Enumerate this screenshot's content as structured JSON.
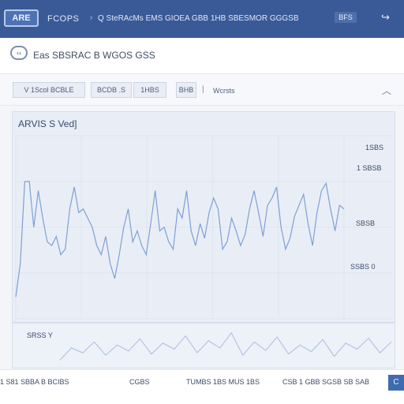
{
  "topbar": {
    "logo_text": "ARE",
    "app_name": "FCOPS",
    "nav_links": "Q SteRAcMs EMS GIOEA GBB 1HB SBESMOR GGGSB",
    "right_button": "BFS",
    "right_arrow": "↪"
  },
  "subheader": {
    "back_icon": "back-icon",
    "title": "Eas SBSRAC B WGOS GSS"
  },
  "filters": {
    "chips": [
      "V 1Scol BCBLE",
      "BCDB .S",
      "1HBS"
    ],
    "dropdown": "BHB",
    "separator": "|",
    "label": "Wcrsts",
    "collapse_icon": "chevron-up-icon"
  },
  "chart_data": {
    "type": "line",
    "title": "ARVIS S Ved]",
    "y_tick_labels": [
      "1SBS",
      "1 SBSB",
      "SBSB",
      "SSBS 0"
    ],
    "series": [
      {
        "values": [
          12,
          30,
          75,
          75,
          50,
          70,
          55,
          42,
          40,
          45,
          35,
          38,
          60,
          72,
          58,
          60,
          55,
          50,
          40,
          35,
          45,
          30,
          22,
          35,
          50,
          60,
          42,
          48,
          40,
          35,
          52,
          70,
          48,
          50,
          42,
          38,
          60,
          55,
          70,
          48,
          40,
          52,
          44,
          58,
          66,
          60,
          38,
          42,
          55,
          48,
          40,
          46,
          60,
          70,
          58,
          45,
          62,
          66,
          72,
          50,
          38,
          44,
          56,
          62,
          68,
          52,
          40,
          58,
          70,
          74,
          60,
          48,
          62,
          60
        ]
      }
    ],
    "ylim": [
      0,
      100
    ],
    "grid": true
  },
  "mini_chart": {
    "label": "SRSS Y",
    "values": [
      10,
      30,
      22,
      40,
      18,
      35,
      25,
      45,
      20,
      38,
      28,
      50,
      22,
      42,
      30,
      55,
      18,
      40,
      26,
      48,
      20,
      35,
      24,
      44,
      16,
      38,
      28,
      46,
      22,
      40
    ]
  },
  "footer": {
    "left_text": "1 S81 SBBA B BCIBS",
    "center_left": "CGBS",
    "center_right": "TUMBS 1BS MUS 1BS",
    "right_text": "CSB 1 GBB SGSB SB SAB",
    "corner_icon": "C"
  },
  "colors": {
    "topbar": "#3a5a97",
    "line": "#7f9fd6",
    "panel": "#e9eef6"
  }
}
